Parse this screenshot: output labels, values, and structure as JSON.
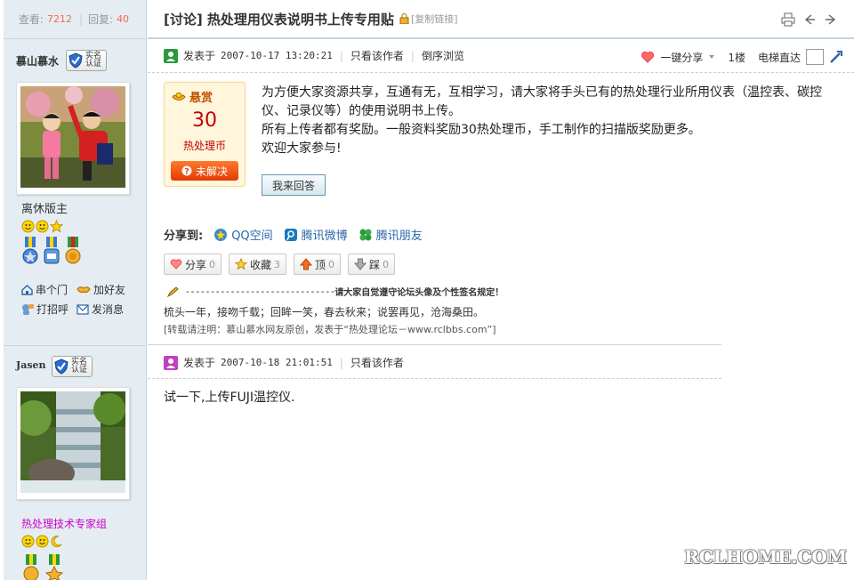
{
  "stats": {
    "views_label": "查看:",
    "views": "7212",
    "replies_label": "回复:",
    "replies": "40"
  },
  "thread": {
    "title": "[讨论] 热处理用仪表说明书上传专用贴",
    "copy_link": "[复制链接]"
  },
  "post1": {
    "author": "慕山慕水",
    "verify_badge": [
      "实名",
      "认证"
    ],
    "rank": "离休版主",
    "meta_label": "发表于",
    "date": "2007-10-17 13:20:21",
    "only_author": "只看该作者",
    "reverse": "倒序浏览",
    "share_top": "一键分享",
    "floor": "1楼",
    "elevator": "电梯直达",
    "reward": {
      "title": "悬赏",
      "amount": "30",
      "unit": "热处理币",
      "status": "未解决"
    },
    "body": [
      "为方便大家资源共享，互通有无，互相学习，请大家将手头已有的热处理行业所用仪表（温控表、碳控仪、记录仪等）的使用说明书上传。",
      "所有上传者都有奖励。一般资料奖励30热处理币，手工制作的扫描版奖励更多。",
      "欢迎大家参与!"
    ],
    "reply_button": "我来回答",
    "share_label": "分享到:",
    "share_targets": [
      "QQ空间",
      "腾讯微博",
      "腾讯朋友"
    ],
    "votes": [
      {
        "label": "分享",
        "count": "0"
      },
      {
        "label": "收藏",
        "count": "3"
      },
      {
        "label": "顶",
        "count": "0"
      },
      {
        "label": "踩",
        "count": "0"
      }
    ],
    "sig_rule": "请大家自觉遵守论坛头像及个性签名规定！",
    "sig_line1": "梳头一年，接吻千载；回眸一笑，春去秋来；说罢再见，沧海桑田。",
    "sig_line2": "[转载请注明：慕山慕水网友原创，发表于“热处理论坛－www.rclbbs.com”]",
    "actions": [
      "串个门",
      "加好友",
      "打招呼",
      "发消息"
    ]
  },
  "post2": {
    "author": "Jasen",
    "verify_badge": [
      "实名",
      "认证"
    ],
    "rank": "热处理技术专家组",
    "meta_label": "发表于",
    "date": "2007-10-18 21:01:51",
    "only_author": "只看该作者",
    "body": "试一下,上传FUJI温控仪."
  },
  "watermark": "RCLHOME.COM",
  "colors": {
    "accent_red": "#f26c4f",
    "link_blue": "#2b66a8",
    "sidebar_bg": "#e5edf2",
    "rank2_purple": "#cc00cc"
  }
}
